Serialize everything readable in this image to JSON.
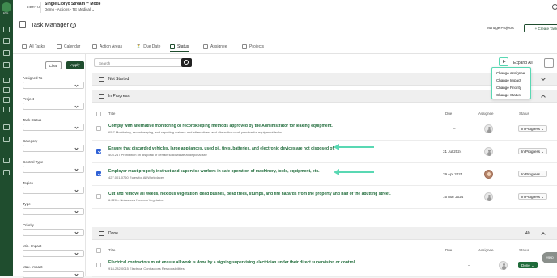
{
  "app": {
    "logo_text": "LIBRYO",
    "logo_sub": "ESG",
    "title": "Single Libryo Stream™ Mode",
    "subtitle": "Demo - Actions - TE Medical",
    "user_initials": "VM"
  },
  "page": {
    "title": "Task Manager",
    "help": "?",
    "manage_projects": "Manage Projects",
    "create_task": "+ Create Task"
  },
  "tabs": [
    {
      "label": "All Tasks",
      "icon": "list-icon"
    },
    {
      "label": "Calendar",
      "icon": "calendar-icon"
    },
    {
      "label": "Action Areas",
      "icon": "folder-icon"
    },
    {
      "label": "Due Date",
      "icon": "hourglass-icon"
    },
    {
      "label": "Status",
      "icon": "bar-chart-icon"
    },
    {
      "label": "Assignee",
      "icon": "people-icon"
    },
    {
      "label": "Projects",
      "icon": "project-icon"
    }
  ],
  "filters": {
    "clear_label": "Clear",
    "apply_label": "Apply",
    "fields": [
      "Assigned To",
      "Project",
      "Task Status",
      "Category",
      "Control Type",
      "Topics",
      "Type",
      "Priority",
      "Min. Impact",
      "Max. Impact"
    ]
  },
  "toolbar": {
    "search_placeholder": "Search",
    "expand_all": "Expand All"
  },
  "bulk_menu": [
    "Change Assignee",
    "Change Impact",
    "Change Priority",
    "Change Status"
  ],
  "columns": {
    "title": "Title",
    "due": "Due",
    "assignee": "Assignee",
    "status": "Status"
  },
  "sections": {
    "not_started": {
      "label": "Not Started"
    },
    "in_progress": {
      "label": "In Progress"
    },
    "done": {
      "label": "Done",
      "count": "40"
    }
  },
  "in_progress_rows": [
    {
      "title": "Comply with alternative monitoring or recordkeeping methods approved by the Administrator for leaking equipment.",
      "sub": "65.7 Monitoring, recordkeeping, and reporting waivers and alternatives, and alternative work practice for equipment leaks",
      "due": "–",
      "status": "In Progress",
      "checked": false
    },
    {
      "title": "Ensure that discarded vehicles, large appliances, used oil, tires, batteries, and electronic devices are not disposed of.",
      "sub": "403.247 Prohibition on disposal of certain solid waste at disposal site",
      "due": "31 Jul 2024",
      "status": "In Progress",
      "checked": true
    },
    {
      "title": "Employer must properly instruct and supervise workers in safe operation of machinery, tools, equipment, etc.",
      "sub": "427.001-0760 Rules for All Workplaces",
      "due": "29 Apr 2024",
      "status": "In Progress",
      "checked": true
    },
    {
      "title": "Cut and remove all weeds, noxious vegetation, dead bushes, dead trees, stumps, and fire hazards from the property and half of the abutting street.",
      "sub": "6.220 – Nuisances Noxious Vegetation",
      "due": "15 Mar 2024",
      "status": "In Progress",
      "checked": false
    }
  ],
  "done_rows": [
    {
      "title": "Electrical contractors must ensure all work is done by a signing supervising electrician under their direct supervision or control.",
      "sub": "918-282-0015 Electrical Contractor's Responsibilities",
      "due": "–",
      "status": "Done"
    }
  ],
  "help_label": "Help",
  "colors": {
    "brand": "#1f4d2e",
    "highlight": "#59d8b3",
    "checkbox": "#2f61d6"
  }
}
